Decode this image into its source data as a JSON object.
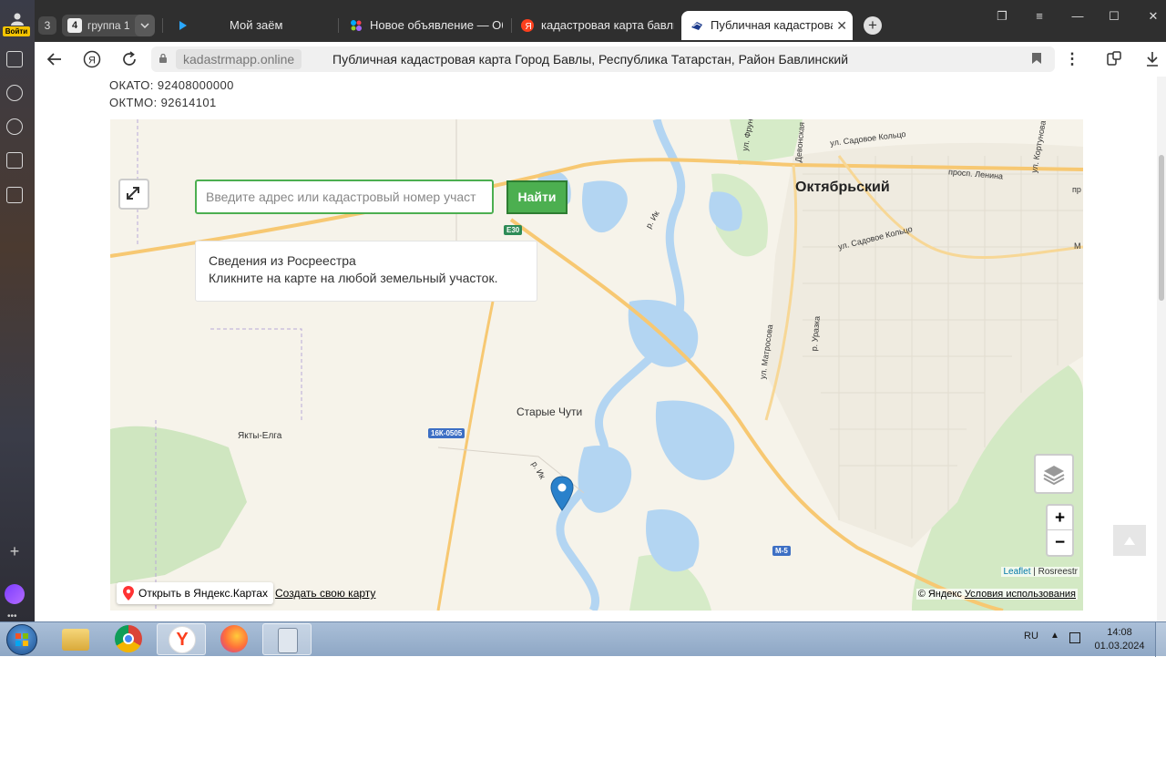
{
  "browser": {
    "login_label": "Войти",
    "tab_counter": "3",
    "group_counter": "4",
    "group_label": "группа 1",
    "tabs": [
      {
        "title": "Мой заём"
      },
      {
        "title": "Новое объявление — Об"
      },
      {
        "title": "кадастровая карта бавлы"
      },
      {
        "title": "Публичная кадастрова"
      }
    ],
    "active_tab_index": 3,
    "domain": "kadastrmapp.online",
    "page_title": "Публичная кадастровая карта Город Бавлы, Республика Татарстан, Район Бавлинский"
  },
  "page": {
    "okato": "ОКАТО: 92408000000",
    "oktmo": "ОКТМО: 92614101"
  },
  "map": {
    "search_placeholder": "Введите адрес или кадастровый номер участ",
    "search_button": "Найти",
    "info_title": "Сведения из Росреестра",
    "info_text": "Кликните на карте на любой земельный участок.",
    "zoom_in": "+",
    "zoom_out": "−",
    "attribution_leaflet": "Leaflet",
    "attribution_sep": " | ",
    "attribution_rosreestr": "Rosreestr",
    "open_in_yandex": "Открыть в Яндекс.Картах",
    "create_map": "Создать свою карту",
    "yandex_copyright": "© Яндекс ",
    "terms_of_use": "Условия использования",
    "labels": {
      "city": "Октябрьский",
      "village_1": "Старые Чути",
      "village_2": "Якты-Елга",
      "street_1": "ул. Садовое Кольцо",
      "street_2": "ул. Садовое Кольцо",
      "street_3": "просп. Ленина",
      "street_4": "ул. Матросова",
      "street_5": "Девонская",
      "street_6": "ул. Кортунова",
      "street_7": "ул. Фрунз",
      "river_1": "р. Ик",
      "river_2": "р. Ик",
      "river_3": "р. Уразка",
      "pr_label": "пр",
      "m_label": "М",
      "road_1": "E30",
      "road_2": "16К-0505",
      "road_3": "М-5"
    }
  },
  "taskbar": {
    "language": "RU",
    "time": "14:08",
    "date": "01.03.2024"
  },
  "colors": {
    "accent_green": "#4caf50",
    "water": "#b3d5f2",
    "road": "#f7c872"
  }
}
